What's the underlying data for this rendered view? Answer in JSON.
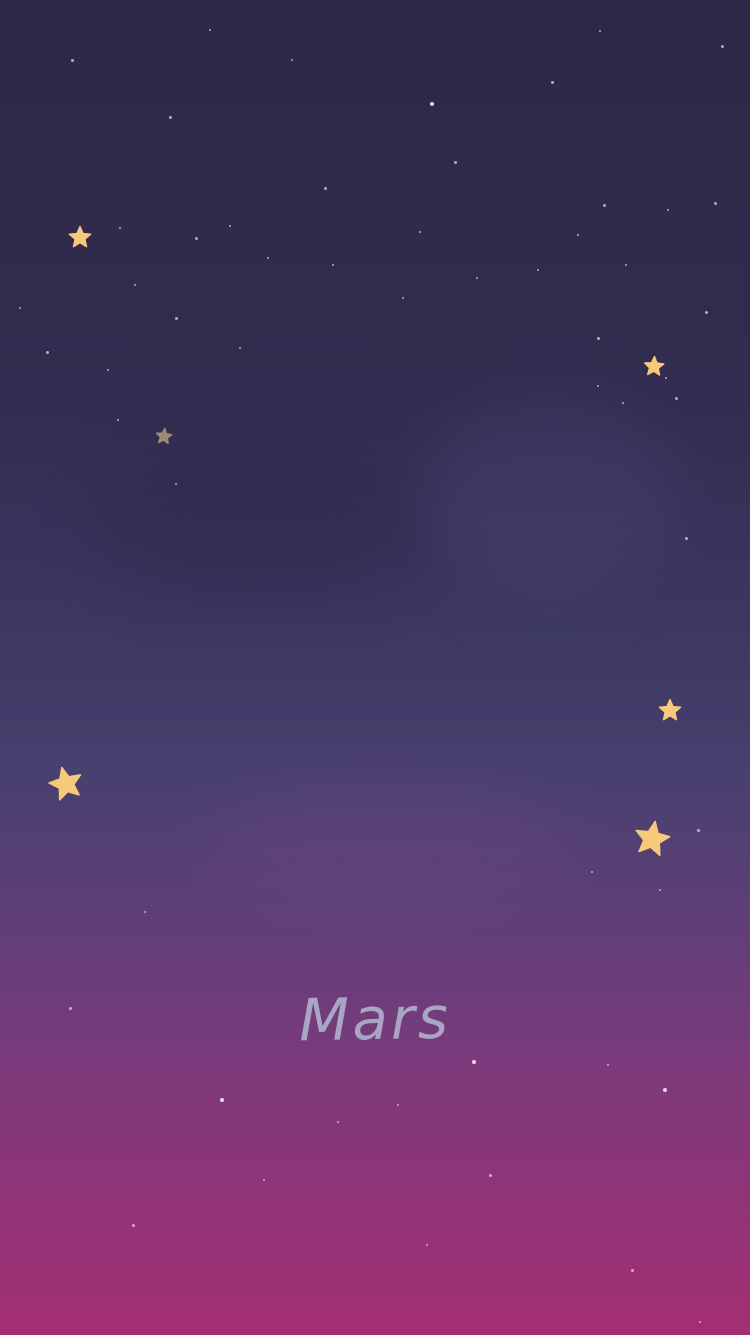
{
  "screen": {
    "title": "Mars"
  },
  "colors": {
    "sky_top": "#2e2847",
    "sky_mid": "#3f3a66",
    "sky_lower": "#6b3d7c",
    "sky_bottom": "#a42e73",
    "star_gold": "#f7c97a",
    "star_dim": "#9c8a72",
    "dot_white": "#e6e2f2",
    "title_text": "#a9a5c4"
  },
  "icons": {
    "star": "star-icon",
    "dot": "sparkle-dot-icon"
  }
}
